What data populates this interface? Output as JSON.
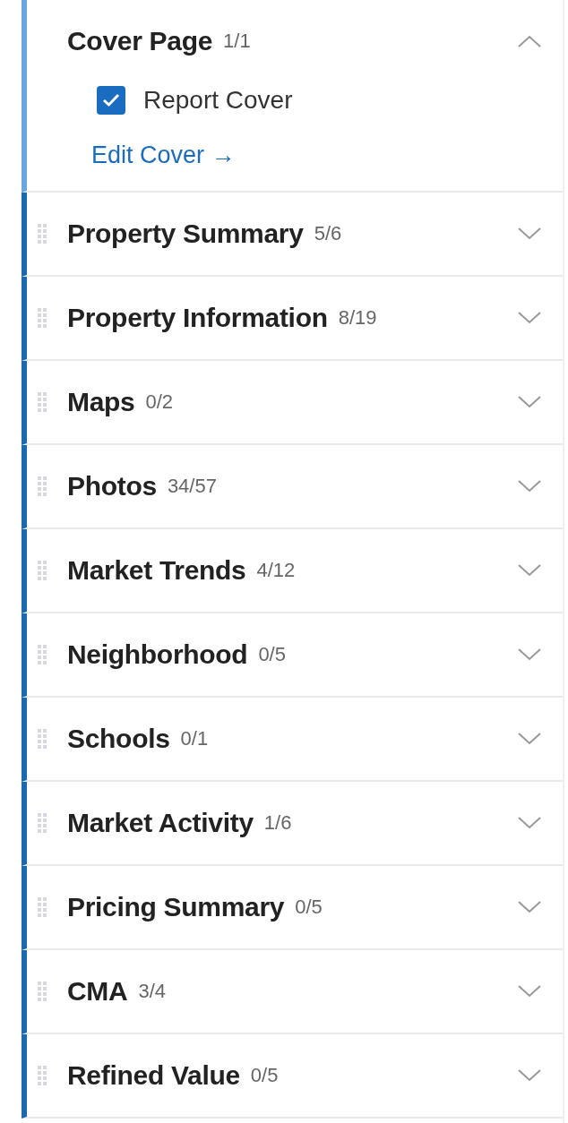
{
  "sections": [
    {
      "kind": "fixed",
      "title": "Cover Page",
      "count": "1/1",
      "expanded": true,
      "items": [
        {
          "label": "Report Cover",
          "checked": true
        }
      ],
      "link": "Edit Cover →"
    },
    {
      "kind": "draggable",
      "title": "Property Summary",
      "count": "5/6",
      "expanded": false
    },
    {
      "kind": "draggable",
      "title": "Property Information",
      "count": "8/19",
      "expanded": false
    },
    {
      "kind": "draggable",
      "title": "Maps",
      "count": "0/2",
      "expanded": false
    },
    {
      "kind": "draggable",
      "title": "Photos",
      "count": "34/57",
      "expanded": false
    },
    {
      "kind": "draggable",
      "title": "Market Trends",
      "count": "4/12",
      "expanded": false
    },
    {
      "kind": "draggable",
      "title": "Neighborhood",
      "count": "0/5",
      "expanded": false
    },
    {
      "kind": "draggable",
      "title": "Schools",
      "count": "0/1",
      "expanded": false
    },
    {
      "kind": "draggable",
      "title": "Market Activity",
      "count": "1/6",
      "expanded": false
    },
    {
      "kind": "draggable",
      "title": "Pricing Summary",
      "count": "0/5",
      "expanded": false
    },
    {
      "kind": "draggable",
      "title": "CMA",
      "count": "3/4",
      "expanded": false
    },
    {
      "kind": "draggable",
      "title": "Refined Value",
      "count": "0/5",
      "expanded": false
    }
  ]
}
